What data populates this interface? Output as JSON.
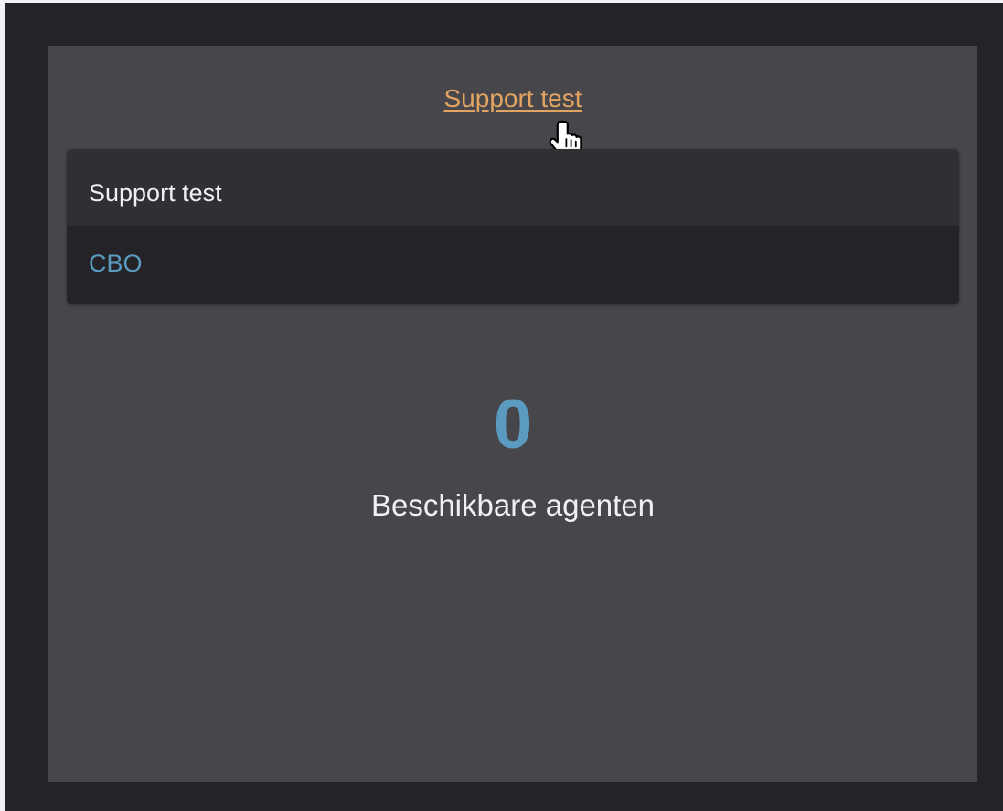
{
  "header": {
    "title_link": "Support test"
  },
  "card": {
    "title": "Support test",
    "subtitle": "CBO"
  },
  "stat": {
    "value": "0",
    "label": "Beschikbare agenten"
  },
  "colors": {
    "page_background": "#232328",
    "panel_background": "#46464b",
    "link": "#e3a462",
    "accent": "#5b9bc0",
    "card_header": "#2f2f34",
    "card_body": "#232328",
    "text": "#f0f0f2"
  },
  "icons": {
    "cursor": "hand-pointer-icon"
  }
}
